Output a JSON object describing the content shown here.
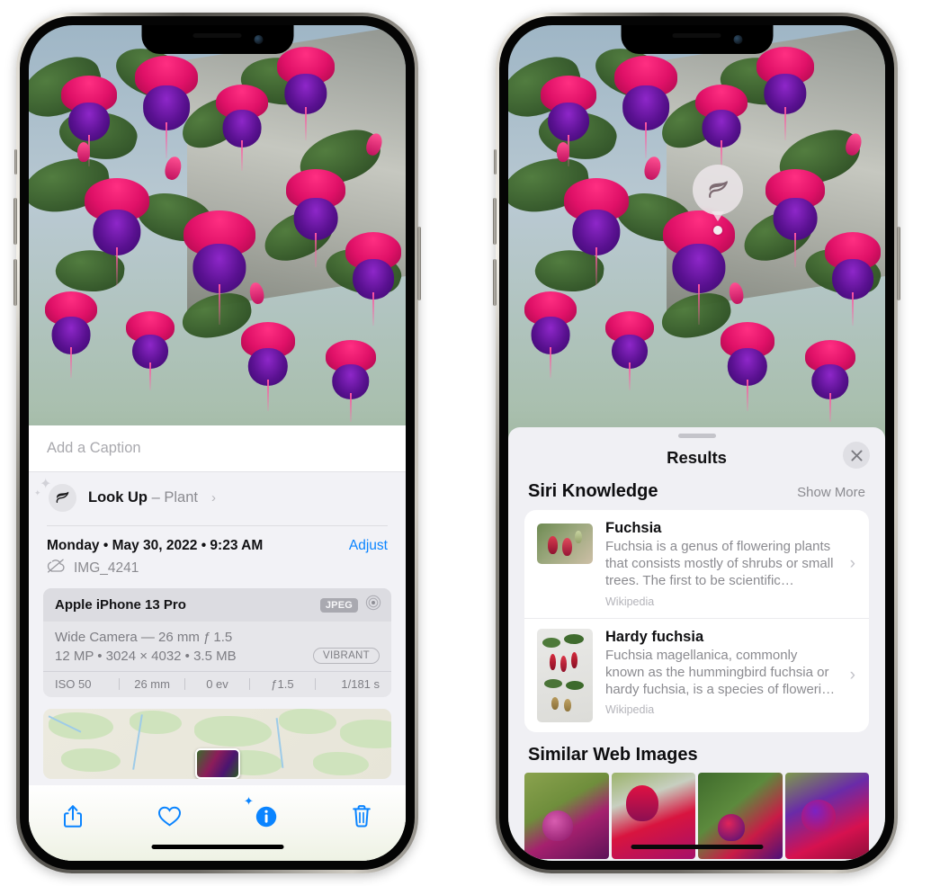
{
  "left_phone": {
    "name": "photos-detail-view",
    "caption": {
      "placeholder": "Add a Caption",
      "value": ""
    },
    "lookup": {
      "icon": "leaf-icon",
      "label": "Look Up",
      "separator": " – ",
      "subject": "Plant",
      "chevron": "›"
    },
    "meta": {
      "date_line": "Monday • May 30, 2022 • 9:23 AM",
      "adjust_label": "Adjust",
      "cloud_icon": "cloud-slash-icon",
      "file_name": "IMG_4241"
    },
    "exif": {
      "device": "Apple iPhone 13 Pro",
      "format_badge": "JPEG",
      "lens_icon": "aperture-icon",
      "line1": "Wide Camera — 26 mm ƒ 1.5",
      "line2": "12 MP • 3024 × 4032 • 3.5 MB",
      "color_badge": "VIBRANT",
      "stats": [
        "ISO 50",
        "26 mm",
        "0 ev",
        "ƒ1.5",
        "1/181 s"
      ]
    },
    "map": {
      "name": "location-map-preview",
      "pin": "photo-pin"
    },
    "toolbar": [
      {
        "name": "share-button",
        "icon": "share-icon"
      },
      {
        "name": "favorite-button",
        "icon": "heart-icon"
      },
      {
        "name": "info-button",
        "icon": "info-sparkle-icon"
      },
      {
        "name": "delete-button",
        "icon": "trash-icon"
      }
    ],
    "accent_color": "#0a84ff"
  },
  "right_phone": {
    "name": "visual-lookup-results",
    "photo_badge": {
      "icon": "leaf-icon",
      "label": "visual-lookup-indicator"
    },
    "sheet": {
      "title": "Results",
      "close_icon": "close-icon",
      "sections": [
        {
          "name": "siri-knowledge",
          "title": "Siri Knowledge",
          "action_label": "Show More",
          "cards": [
            {
              "title": "Fuchsia",
              "description": "Fuchsia is a genus of flowering plants that consists mostly of shrubs or small trees. The first to be scientific…",
              "source": "Wikipedia",
              "thumb": "fuchsia-thumbnail"
            },
            {
              "title": "Hardy fuchsia",
              "description": "Fuchsia magellanica, commonly known as the hummingbird fuchsia or hardy fuchsia, is a species of floweri…",
              "source": "Wikipedia",
              "thumb": "hardy-fuchsia-thumbnail"
            }
          ]
        },
        {
          "name": "similar-web-images",
          "title": "Similar Web Images",
          "thumbnails": [
            "web-image-1",
            "web-image-2",
            "web-image-3",
            "web-image-4"
          ]
        }
      ]
    }
  }
}
